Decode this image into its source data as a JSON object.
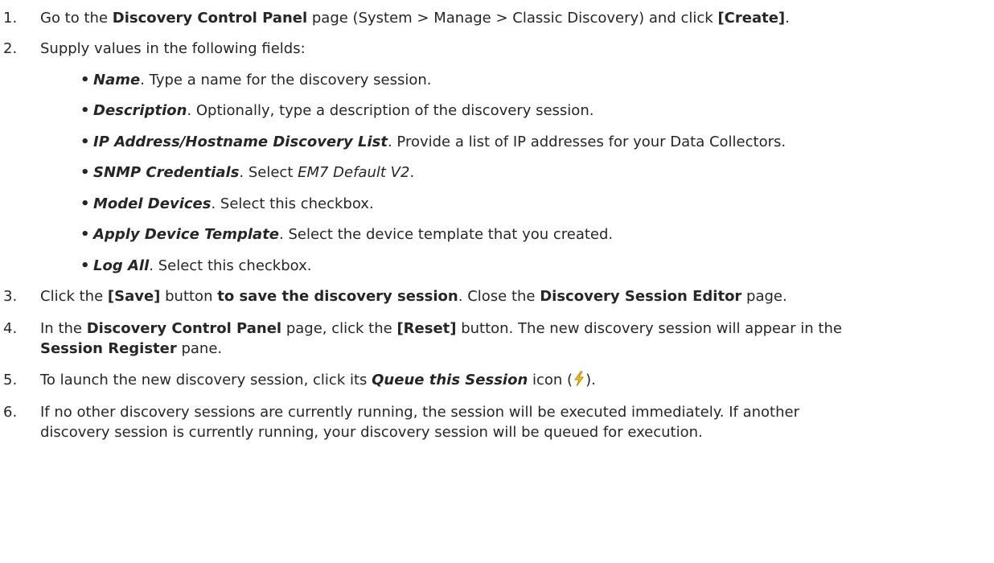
{
  "steps": [
    {
      "num": "1.",
      "t1": "Go to the ",
      "b1": "Discovery Control Panel",
      "t2": " page (System > Manage > Classic Discovery) and click ",
      "b2": "[Create]",
      "t3": "."
    },
    {
      "num": "2.",
      "t1": "Supply values in the following fields:",
      "bullets": [
        {
          "label": "Name",
          "text": ". Type a name for the discovery session."
        },
        {
          "label": "Description",
          "text": ". Optionally, type a description of the discovery session."
        },
        {
          "label": "IP Address/Hostname Discovery List",
          "text": ". Provide a list of IP addresses for your Data Collectors."
        },
        {
          "label": "SNMP Credentials",
          "text": ". Select ",
          "it": "EM7 Default V2",
          "text2": "."
        },
        {
          "label": "Model Devices",
          "text": ". Select this checkbox."
        },
        {
          "label": "Apply Device Template",
          "text": ". Select the device template that you created."
        },
        {
          "label": "Log All",
          "text": ". Select this checkbox."
        }
      ]
    },
    {
      "num": "3.",
      "t1": "Click the ",
      "b1": "[Save]",
      "t2": " button ",
      "b2": "to save the discovery session",
      "t3": ". Close the ",
      "b3": "Discovery Session Editor",
      "t4": " page."
    },
    {
      "num": "4.",
      "t1": "In the ",
      "b1": "Discovery Control Panel",
      "t2": " page, click the ",
      "b2": "[Reset]",
      "t3": " button. The new discovery session will appear in the",
      "b3": "Session Register",
      "t4": " pane."
    },
    {
      "num": "5.",
      "t1": "To launch the new discovery session, click its ",
      "bi1": "Queue this Session",
      "t2": " icon (",
      "icon": "lightning-bolt-icon",
      "t3": ")."
    },
    {
      "num": "6.",
      "t1": "If no other discovery sessions are currently running, the session will be executed immediately. If another",
      "t2": "discovery session is currently running, your discovery session will be queued for execution."
    }
  ],
  "colors": {
    "text": "#262626",
    "icon_fill": "#f2c417",
    "icon_stroke": "#b8860b"
  }
}
